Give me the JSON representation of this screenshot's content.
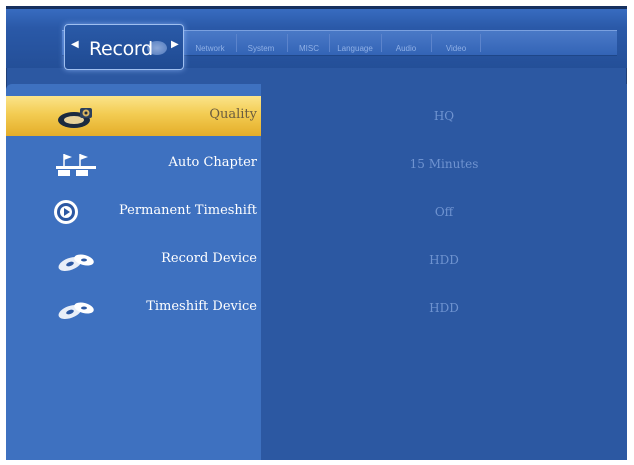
{
  "header": {
    "active_tab": "Record",
    "tabs": [
      "Network",
      "System",
      "MISC",
      "Language",
      "Audio",
      "Video"
    ]
  },
  "settings": [
    {
      "label": "Quality",
      "value": "HQ",
      "icon": "quality-icon",
      "selected": true
    },
    {
      "label": "Auto Chapter",
      "value": "15 Minutes",
      "icon": "auto-chapter-icon",
      "selected": false
    },
    {
      "label": "Permanent Timeshift",
      "value": "Off",
      "icon": "timeshift-icon",
      "selected": false
    },
    {
      "label": "Record Device",
      "value": "HDD",
      "icon": "record-device-icon",
      "selected": false
    },
    {
      "label": "Timeshift Device",
      "value": "HDD",
      "icon": "timeshift-device-icon",
      "selected": false
    }
  ],
  "colors": {
    "background": "#2c58a2",
    "left_panel": "#3e71c0",
    "selected": "#f3cc52"
  }
}
